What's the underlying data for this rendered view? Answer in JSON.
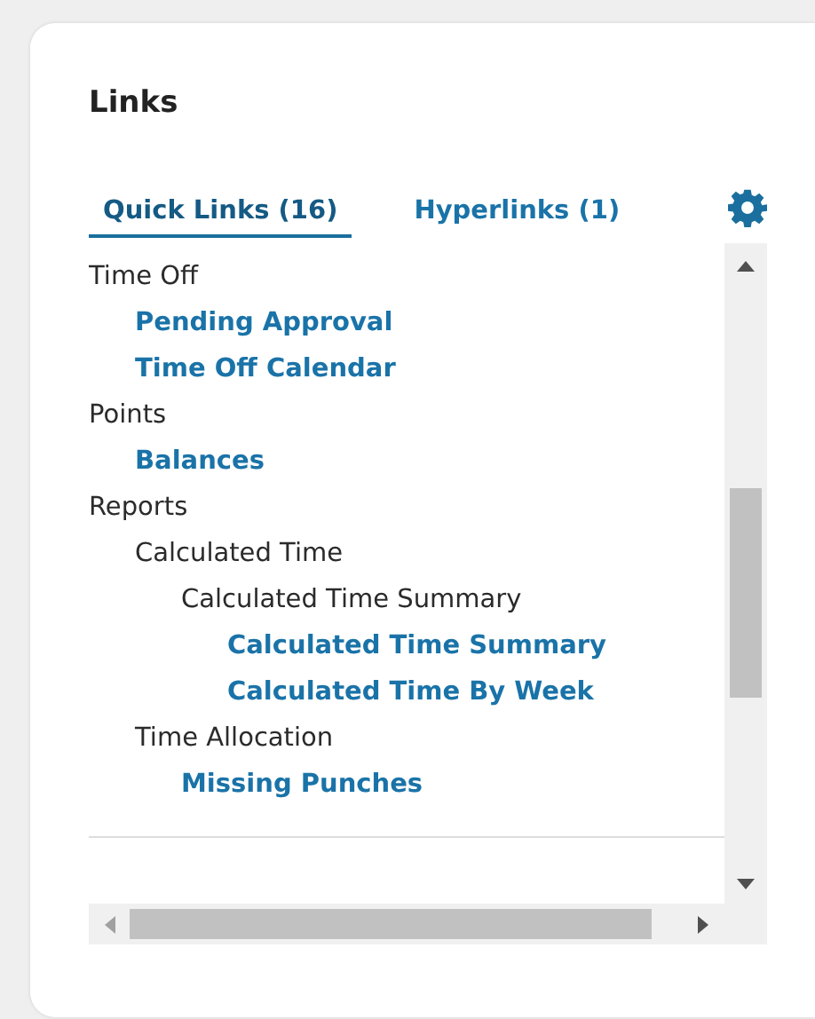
{
  "panel": {
    "title": "Links"
  },
  "tabs": [
    {
      "label": "Quick Links (16)",
      "selected": true
    },
    {
      "label": "Hyperlinks (1)",
      "selected": false
    }
  ],
  "tree": [
    {
      "label": "Time Off",
      "kind": "group",
      "children": [
        {
          "label": "Pending Approval",
          "kind": "link"
        },
        {
          "label": "Time Off Calendar",
          "kind": "link"
        }
      ]
    },
    {
      "label": "Points",
      "kind": "group",
      "children": [
        {
          "label": "Balances",
          "kind": "link"
        }
      ]
    },
    {
      "label": "Reports",
      "kind": "group",
      "children": [
        {
          "label": "Calculated Time",
          "kind": "group",
          "children": [
            {
              "label": "Calculated Time Summary",
              "kind": "group",
              "children": [
                {
                  "label": "Calculated Time Summary",
                  "kind": "link"
                },
                {
                  "label": "Calculated Time By Week",
                  "kind": "link"
                }
              ]
            }
          ]
        },
        {
          "label": "Time Allocation",
          "kind": "group",
          "children": [
            {
              "label": "Missing Punches",
              "kind": "link"
            }
          ]
        }
      ]
    }
  ]
}
